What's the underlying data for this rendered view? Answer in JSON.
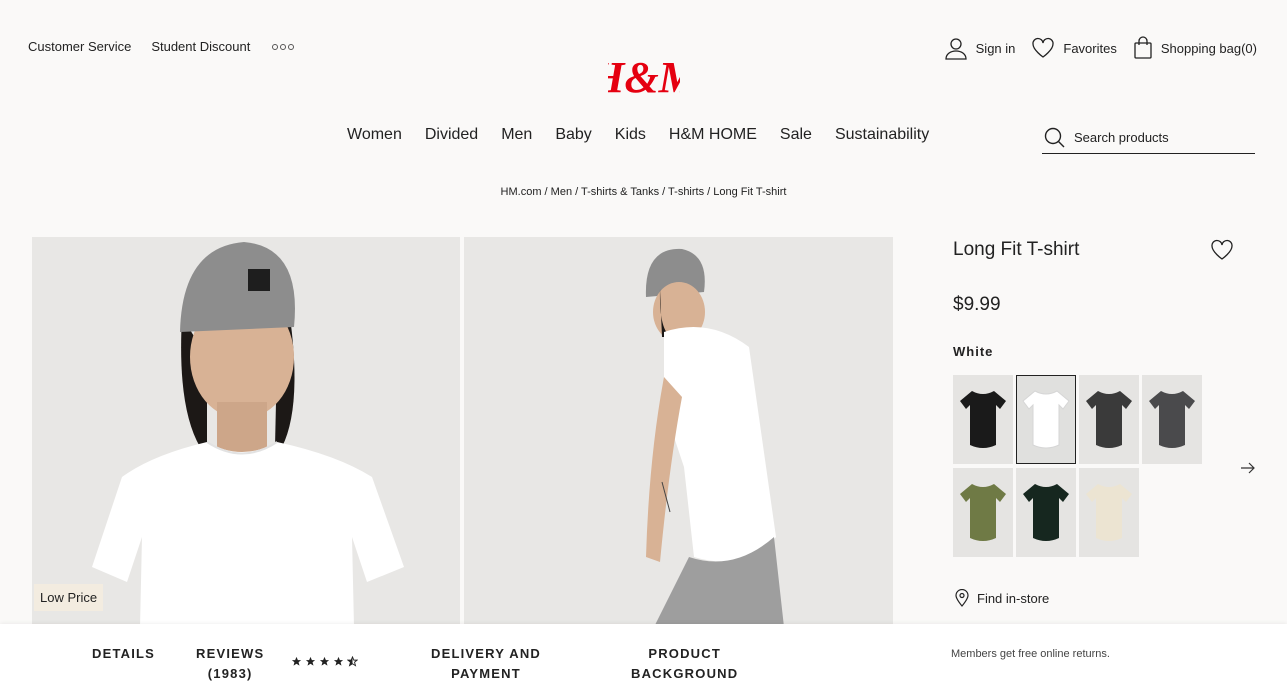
{
  "header": {
    "top_links": [
      "Customer Service",
      "Student Discount"
    ],
    "more_icon": "more-dots-icon",
    "logo_text": "H&M",
    "brand_color": "#e50010",
    "account": {
      "sign_in": "Sign in",
      "favorites": "Favorites",
      "bag": "Shopping bag(0)"
    }
  },
  "nav": {
    "items": [
      "Women",
      "Divided",
      "Men",
      "Baby",
      "Kids",
      "H&M HOME",
      "Sale",
      "Sustainability"
    ]
  },
  "search": {
    "placeholder": "Search products"
  },
  "breadcrumb": "HM.com / Men / T-shirts & Tanks / T-shirts / Long Fit T-shirt",
  "gallery": {
    "badge": "Low Price"
  },
  "product": {
    "title": "Long Fit T-shirt",
    "price": "$9.99",
    "selected_color": "White",
    "swatches": [
      {
        "color": "#1a1a1a",
        "name": "black"
      },
      {
        "color": "#ffffff",
        "name": "white",
        "selected": true
      },
      {
        "color": "#3a3a3a",
        "name": "dark-gray"
      },
      {
        "color": "#4a4a4c",
        "name": "gray"
      },
      {
        "color": "#6f7a45",
        "name": "khaki-green"
      },
      {
        "color": "#16271f",
        "name": "dark-green"
      },
      {
        "color": "#ece4d2",
        "name": "beige"
      }
    ],
    "find_in_store": "Find in-store"
  },
  "bottom_bar": {
    "details": "DETAILS",
    "reviews_line1": "REVIEWS",
    "reviews_line2": "(1983)",
    "rating": 4.5,
    "delivery_line1": "DELIVERY AND",
    "delivery_line2": "PAYMENT",
    "background_line1": "PRODUCT",
    "background_line2": "BACKGROUND",
    "returns_note": "Members get free online returns."
  }
}
